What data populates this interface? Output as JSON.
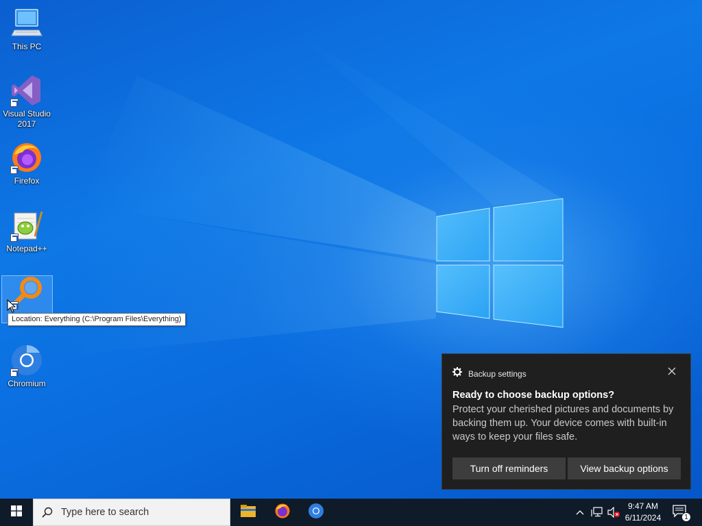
{
  "desktop": {
    "icons": [
      {
        "label": "This PC"
      },
      {
        "label": "Visual Studio 2017"
      },
      {
        "label": "Firefox"
      },
      {
        "label": "Notepad++"
      },
      {
        "label": "Everything"
      },
      {
        "label": "Chromium"
      }
    ],
    "tooltip": "Location: Everything (C:\\Program Files\\Everything)"
  },
  "toast": {
    "app_name": "Backup settings",
    "title": "Ready to choose backup options?",
    "body": "Protect your cherished pictures and documents by backing them up. Your device comes with built-in ways to keep your files safe.",
    "button_secondary": "Turn off reminders",
    "button_primary": "View backup options"
  },
  "taskbar": {
    "search_placeholder": "Type here to search",
    "pinned_apps": [
      "file-explorer",
      "firefox",
      "chromium"
    ],
    "clock": {
      "time": "9:47 AM",
      "date": "6/11/2024"
    },
    "notification_count": "1"
  }
}
